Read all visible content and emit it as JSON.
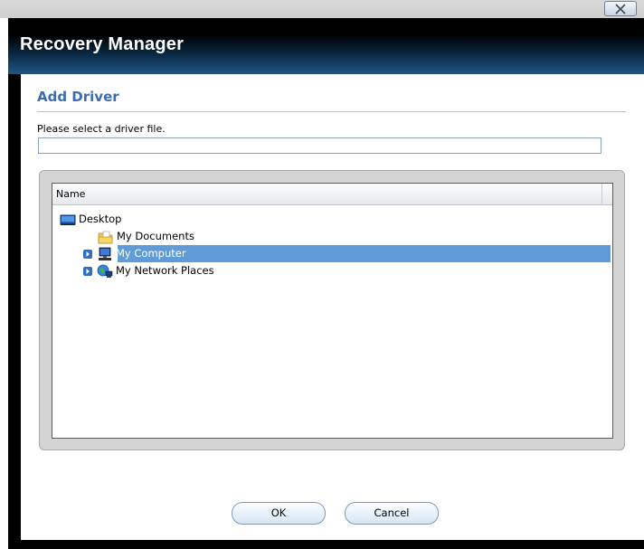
{
  "window": {
    "title": "Recovery Manager",
    "close_icon": "close-icon"
  },
  "dialog": {
    "heading": "Add Driver",
    "prompt": "Please select a driver file.",
    "path_value": "",
    "column_header": "Name",
    "tree": [
      {
        "label": "Desktop",
        "icon": "desktop-icon",
        "expandable": false,
        "selected": false,
        "level": 0
      },
      {
        "label": "My Documents",
        "icon": "folder-documents-icon",
        "expandable": false,
        "selected": false,
        "level": 1
      },
      {
        "label": "My Computer",
        "icon": "computer-icon",
        "expandable": true,
        "selected": true,
        "level": 1
      },
      {
        "label": "My Network Places",
        "icon": "network-places-icon",
        "expandable": true,
        "selected": false,
        "level": 1
      }
    ],
    "ok_label": "OK",
    "cancel_label": "Cancel"
  },
  "colors": {
    "heading": "#3b6db3",
    "selection": "#5f9bd6",
    "title_bar": "#000000"
  }
}
